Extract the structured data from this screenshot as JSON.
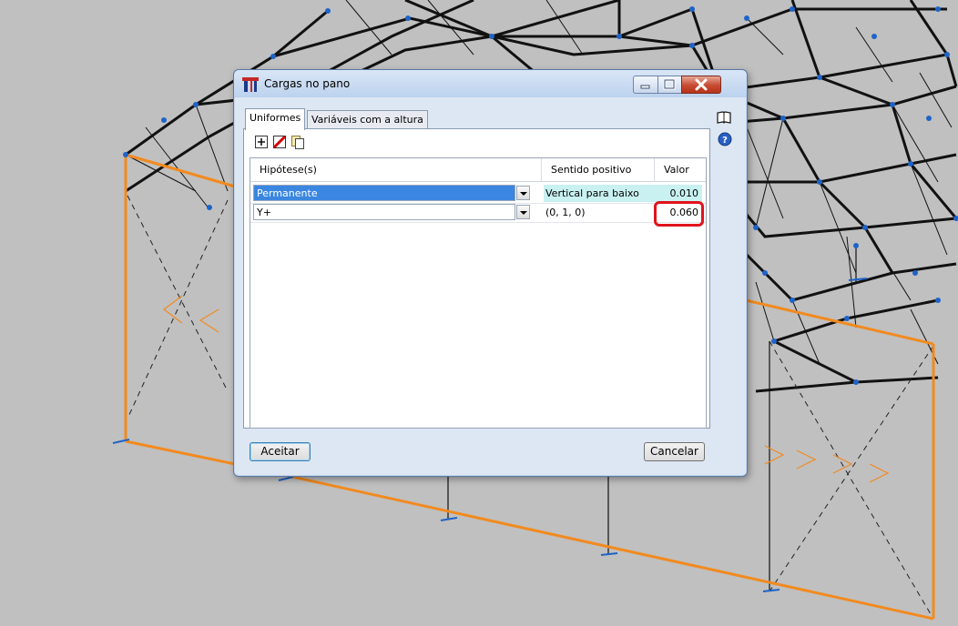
{
  "window": {
    "title": "Cargas no pano",
    "minimize_icon": "minimize-icon",
    "maximize_icon": "maximize-icon",
    "close_icon": "close-icon"
  },
  "tabs": [
    {
      "label": "Uniformes",
      "active": true
    },
    {
      "label": "Variáveis com a altura",
      "active": false
    }
  ],
  "toolbar": {
    "icons": [
      "add-row-icon",
      "delete-row-icon",
      "copy-icon"
    ]
  },
  "side_icons": [
    "book-icon",
    "help-icon"
  ],
  "table": {
    "columns": [
      "Hipótese(s)",
      "Sentido positivo",
      "Valor"
    ],
    "rows": [
      {
        "hipotese": "Permanente",
        "sentido": "Vertical para baixo",
        "valor": "0.010",
        "selected": true
      },
      {
        "hipotese": "Y+",
        "sentido": "(0, 1, 0)",
        "valor": "0.060",
        "selected": false,
        "highlighted": true
      }
    ]
  },
  "buttons": {
    "accept": "Aceitar",
    "cancel": "Cancelar"
  },
  "colors": {
    "structure_orange": "#f28a1f",
    "node_blue": "#1e63c8",
    "highlight_red": "#e0131c",
    "selection_blue": "#3a86e0"
  }
}
